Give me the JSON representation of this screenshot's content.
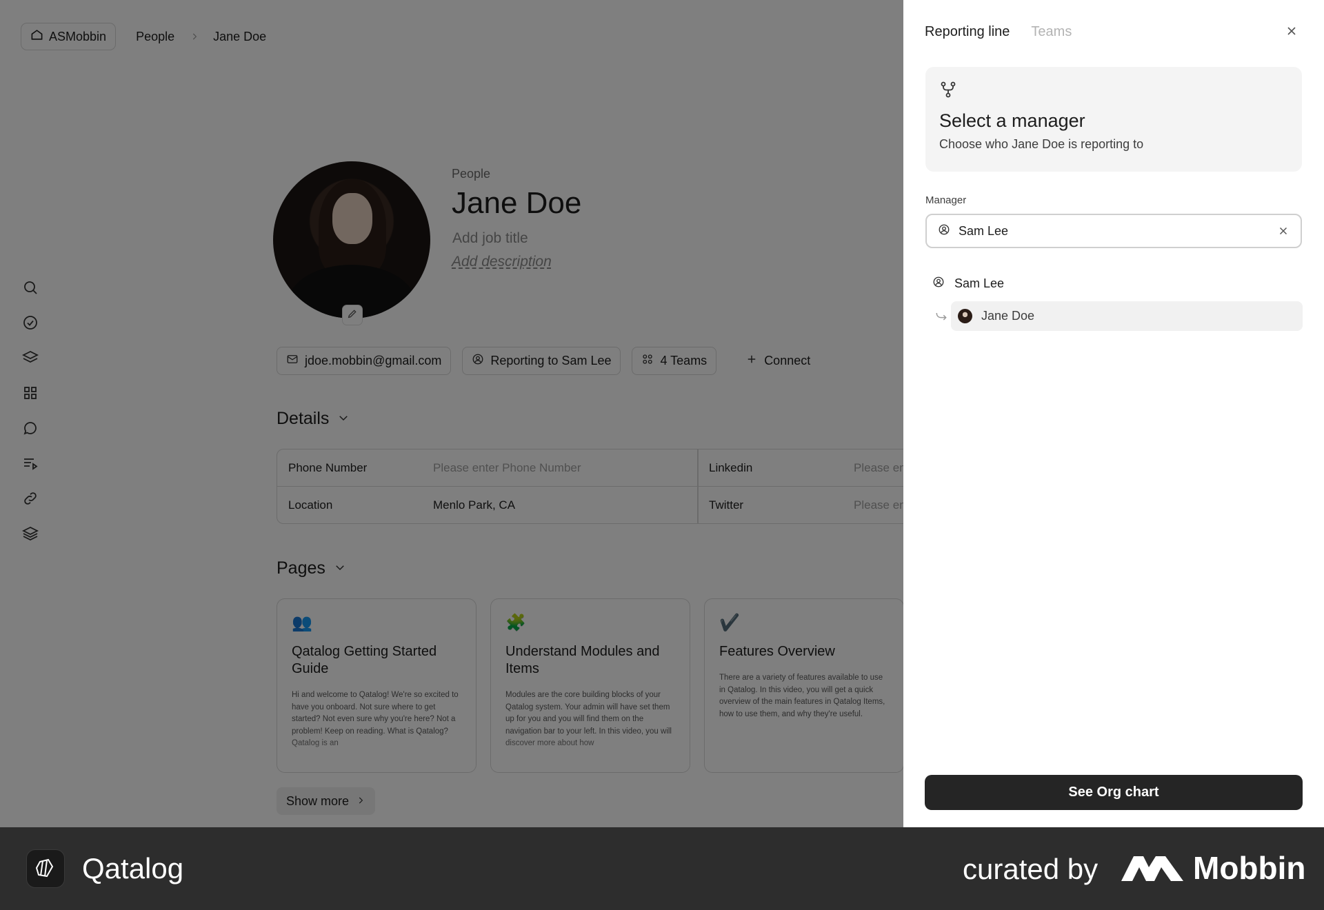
{
  "breadcrumb": {
    "workspace": "ASMobbin",
    "items": [
      "People",
      "Jane Doe"
    ]
  },
  "profile": {
    "kind": "People",
    "name": "Jane Doe",
    "job_title_placeholder": "Add job title",
    "description_placeholder": "Add description"
  },
  "chips": {
    "email": "jdoe.mobbin@gmail.com",
    "reporting": "Reporting to Sam Lee",
    "teams": "4 Teams",
    "connect": "Connect"
  },
  "details": {
    "heading": "Details",
    "rows": [
      {
        "label": "Phone Number",
        "value": "Please enter Phone Number",
        "label2": "Linkedin",
        "value2": "Please en"
      },
      {
        "label": "Location",
        "value": "Menlo Park, CA",
        "label2": "Twitter",
        "value2": "Please en"
      }
    ]
  },
  "pages": {
    "heading": "Pages",
    "cards": [
      {
        "emoji": "👥",
        "title": "Qatalog Getting Started Guide",
        "body": "Hi and welcome to Qatalog! We're so excited to have you onboard. Not sure where to get started? Not even sure why you're here? Not a problem! Keep on reading. What is Qatalog? Qatalog is an"
      },
      {
        "emoji": "🧩",
        "title": "Understand Modules and Items",
        "body": "Modules are the core building blocks of your Qatalog system. Your admin will have set them up for you and you will find them on the navigation bar to your left. In this video, you will discover more about how"
      },
      {
        "emoji": "✔️",
        "title": "Features Overview",
        "body": "There are a variety of features available to use in Qatalog. In this video, you will get a quick overview of the main features in Qatalog Items, how to use them, and why they're useful."
      }
    ],
    "show_more": "Show more"
  },
  "panel": {
    "tabs": [
      "Reporting line",
      "Teams"
    ],
    "active_tab": "Reporting line",
    "hero_title": "Select a manager",
    "hero_subtitle": "Choose who Jane Doe is reporting to",
    "manager_label": "Manager",
    "manager_value": "Sam Lee",
    "tree": {
      "manager": "Sam Lee",
      "report": "Jane Doe"
    },
    "org_button": "See Org chart"
  },
  "footer": {
    "brand": "Qatalog",
    "curated_by": "curated by",
    "curator": "Mobbin"
  },
  "colors": {
    "overlay": "#7c7c7c",
    "footer_bg": "#2d2d2d",
    "primary_button": "#252525",
    "inactive_tab": "#b3b3b3"
  },
  "icons": {
    "rail": [
      "search-icon",
      "check-circle-icon",
      "layers-icon",
      "grid-icon",
      "chat-bubble-icon",
      "list-play-icon",
      "link-icon",
      "stack-icon"
    ]
  }
}
